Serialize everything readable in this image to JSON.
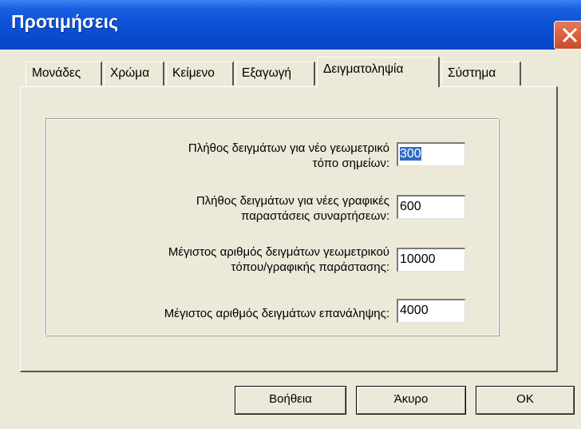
{
  "window": {
    "title": "Προτιμήσεις"
  },
  "tabs": [
    {
      "label": "Μονάδες"
    },
    {
      "label": "Χρώμα"
    },
    {
      "label": "Κείμενο"
    },
    {
      "label": "Εξαγωγή"
    },
    {
      "label": "Δειγματοληψία",
      "active": true
    },
    {
      "label": "Σύστημα"
    }
  ],
  "fields": [
    {
      "label_line1": "Πλήθος δειγμάτων για νέο γεωμετρικό",
      "label_line2": "τόπο σημείων:",
      "value": "300"
    },
    {
      "label_line1": "Πλήθος δειγμάτων για νέες γραφικές",
      "label_line2": "παραστάσεις συναρτήσεων:",
      "value": "600"
    },
    {
      "label_line1": "Μέγιστος αριθμός δειγμάτων γεωμετρικού",
      "label_line2": "τόπου/γραφικής παράστασης:",
      "value": "10000"
    },
    {
      "label_line1": "Μέγιστος αριθμός δειγμάτων επανάληψης:",
      "value": "4000"
    }
  ],
  "buttons": {
    "help": "Βοήθεια",
    "cancel": "Άκυρο",
    "ok": "OK"
  },
  "icons": {
    "close": "close-icon"
  }
}
